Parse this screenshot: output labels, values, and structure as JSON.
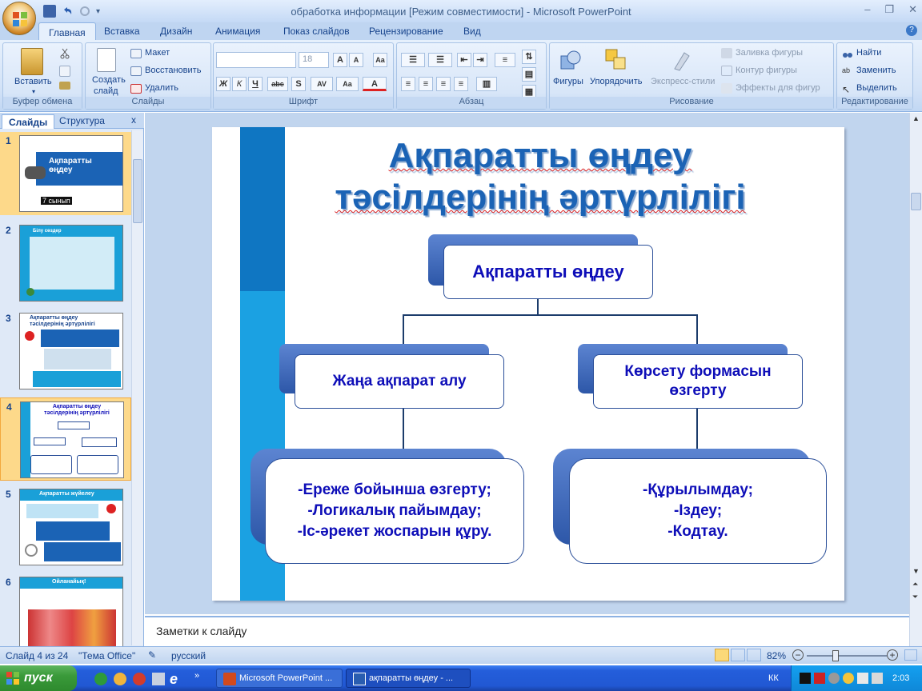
{
  "window": {
    "title": "обработка информации [Режим совместимости] - Microsoft PowerPoint"
  },
  "tabs": [
    "Главная",
    "Вставка",
    "Дизайн",
    "Анимация",
    "Показ слайдов",
    "Рецензирование",
    "Вид"
  ],
  "ribbon": {
    "clipboard": {
      "label": "Буфер обмена",
      "paste": "Вставить"
    },
    "slides": {
      "label": "Слайды",
      "new_slide_1": "Создать",
      "new_slide_2": "слайд",
      "layout": "Макет",
      "reset": "Восстановить",
      "delete": "Удалить"
    },
    "font": {
      "label": "Шрифт",
      "size": "18"
    },
    "paragraph": {
      "label": "Абзац"
    },
    "drawing": {
      "label": "Рисование",
      "shapes": "Фигуры",
      "arrange": "Упорядочить",
      "quick_styles": "Экспресс-стили",
      "fill": "Заливка фигуры",
      "outline": "Контур фигуры",
      "effects": "Эффекты для фигур"
    },
    "editing": {
      "label": "Редактирование",
      "find": "Найти",
      "replace": "Заменить",
      "select": "Выделить"
    }
  },
  "panel": {
    "tab_slides": "Слайды",
    "tab_outline": "Структура",
    "close": "x"
  },
  "thumbnails": [
    {
      "num": "1",
      "title": "Ақпаратты өңдеу",
      "sub": "7 сынып"
    },
    {
      "num": "2",
      "title": "Білу сөздер"
    },
    {
      "num": "3",
      "title": "Ақпаратты өңдеу тәсілдерінің әртүрлілігі"
    },
    {
      "num": "4",
      "title": "Ақпаратты өңдеу тәсілдерінің әртүрлілігі"
    },
    {
      "num": "5",
      "title": "Ақпаратты жүйелеу"
    },
    {
      "num": "6",
      "title": "Ойланайық!"
    }
  ],
  "slide": {
    "title_line1": "Ақпаратты өңдеу",
    "title_line2": "тәсілдерінің әртүрлілігі",
    "root": "Ақпаратты өңдеу",
    "left_node": "Жаңа ақпарат алу",
    "right_node_1": "Көрсету формасын",
    "right_node_2": "өзгерту",
    "left_leaf": [
      "-Ереже бойынша өзгерту;",
      "-Логикалық пайымдау;",
      "-Іс-әрекет жоспарын құру."
    ],
    "right_leaf": [
      "-Құрылымдау;",
      "-Іздеу;",
      "-Кодтау."
    ]
  },
  "notes": {
    "placeholder": "Заметки к слайду"
  },
  "status": {
    "slide": "Слайд 4 из 24",
    "theme": "\"Тема Office\"",
    "lang": "русский",
    "zoom": "82%"
  },
  "taskbar": {
    "start": "пуск",
    "task1": "Microsoft PowerPoint ...",
    "task2": "ақпаратты өңдеу - ...",
    "lang": "КК",
    "time": "2:03"
  },
  "colors": {
    "accent": "#0e0eb8",
    "ribbon": "#d2e2f7",
    "slide_band": "#1ba1e2"
  }
}
